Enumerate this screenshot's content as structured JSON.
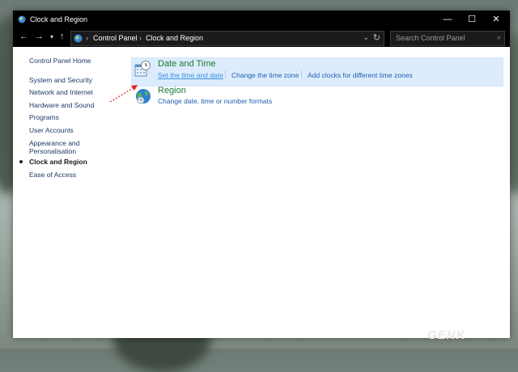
{
  "window": {
    "title": "Clock and Region"
  },
  "window_buttons": {
    "minimize": "—",
    "maximize": "☐",
    "close": "✕"
  },
  "nav": {
    "back": "←",
    "forward": "→",
    "recent": "▾",
    "up": "↑"
  },
  "address": {
    "crumbs": [
      "Control Panel",
      "Clock and Region"
    ],
    "separator": "›",
    "dropdown": "⌄",
    "refresh": "↻"
  },
  "search": {
    "placeholder": "Search Control Panel",
    "icon": "⌕"
  },
  "sidebar": {
    "items": [
      {
        "label": "Control Panel Home"
      },
      {
        "label": "System and Security"
      },
      {
        "label": "Network and Internet"
      },
      {
        "label": "Hardware and Sound"
      },
      {
        "label": "Programs"
      },
      {
        "label": "User Accounts"
      },
      {
        "label": "Appearance and"
      },
      {
        "label": "Personalisation"
      },
      {
        "label": "Clock and Region",
        "active": true
      },
      {
        "label": "Ease of Access"
      }
    ]
  },
  "categories": [
    {
      "title": "Date and Time",
      "icon": "calendar-clock-icon",
      "links": [
        "Set the time and date",
        "Change the time zone",
        "Add clocks for different time zones"
      ]
    },
    {
      "title": "Region",
      "icon": "globe-icon",
      "links": [
        "Change date, time or number formats"
      ]
    }
  ],
  "watermark": "GENK",
  "colors": {
    "category_title": "#1e7b33",
    "link": "#1c5fae",
    "hover_highlight": "#dcecfc",
    "annotation_arrow": "#e02020"
  }
}
